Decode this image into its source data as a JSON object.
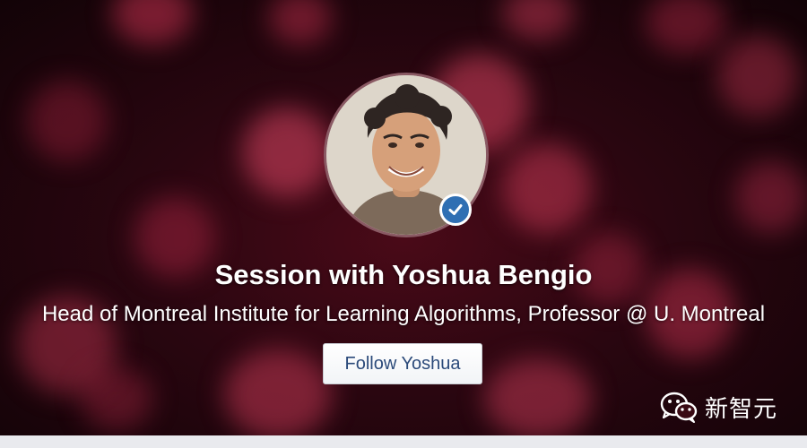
{
  "profile": {
    "title": "Session with Yoshua Bengio",
    "subtitle": "Head of Montreal Institute for Learning Algorithms, Professor @ U. Montreal",
    "avatar_icon": "person-portrait-icon",
    "verified_icon": "checkmark-icon",
    "follow_label": "Follow Yoshua"
  },
  "watermark": {
    "icon": "wechat-icon",
    "text": "新智元"
  },
  "colors": {
    "background": "#2a0610",
    "bokeh": "#c8324f",
    "button_text": "#2b4a7a",
    "verified_badge": "#2f6fb3"
  }
}
